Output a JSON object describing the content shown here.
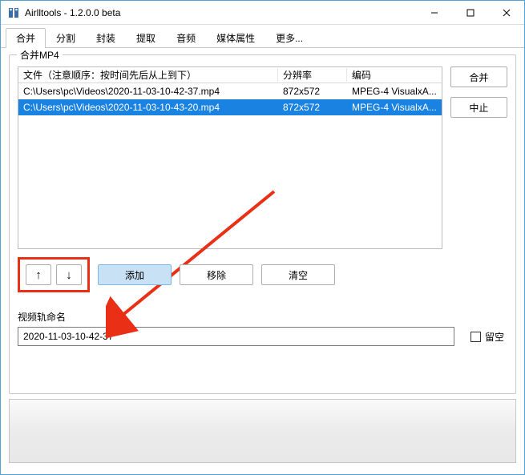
{
  "window": {
    "title": "Airlltools  -  1.2.0.0 beta"
  },
  "tabs": {
    "items": [
      {
        "label": "合并"
      },
      {
        "label": "分割"
      },
      {
        "label": "封装"
      },
      {
        "label": "提取"
      },
      {
        "label": "音频"
      },
      {
        "label": "媒体属性"
      },
      {
        "label": "更多..."
      }
    ],
    "active_index": 0
  },
  "panel": {
    "title": "合并MP4",
    "columns": {
      "file": "文件（注意顺序：按时间先后从上到下）",
      "res": "分辨率",
      "enc": "编码"
    },
    "rows": [
      {
        "file": "C:\\Users\\pc\\Videos\\2020-11-03-10-42-37.mp4",
        "res": "872x572",
        "enc": "MPEG-4 VisualxA..."
      },
      {
        "file": "C:\\Users\\pc\\Videos\\2020-11-03-10-43-20.mp4",
        "res": "872x572",
        "enc": "MPEG-4 VisualxA..."
      }
    ],
    "selected_index": 1,
    "side_buttons": {
      "merge": "合并",
      "stop": "中止"
    },
    "up_label": "↑",
    "down_label": "↓",
    "add_label": "添加",
    "remove_label": "移除",
    "clear_label": "清空",
    "name_label": "视频轨命名",
    "name_value": "2020-11-03-10-42-37",
    "empty_label": "留空"
  }
}
